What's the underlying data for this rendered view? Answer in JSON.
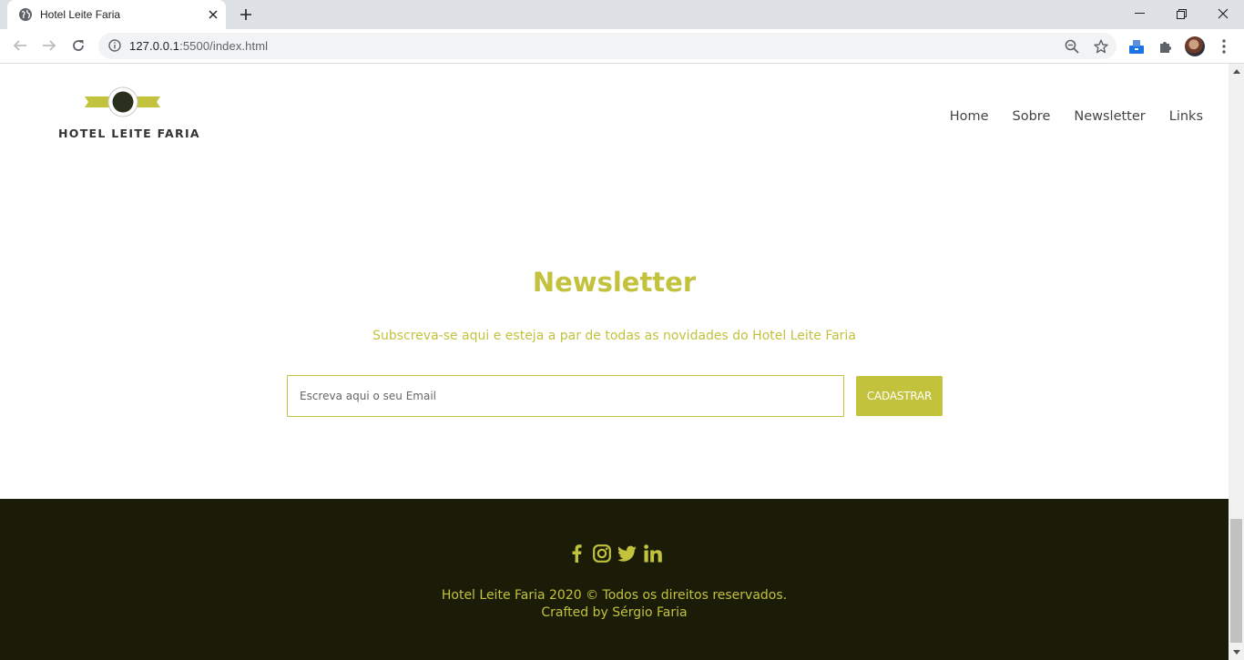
{
  "browser": {
    "tab_title": "Hotel Leite Faria",
    "url_host": "127.0.0.1",
    "url_rest": ":5500/index.html"
  },
  "header": {
    "logo_text": "HOTEL LEITE FARIA",
    "nav": [
      "Home",
      "Sobre",
      "Newsletter",
      "Links"
    ]
  },
  "newsletter": {
    "title": "Newsletter",
    "subtitle": "Subscreva-se aqui e esteja a par de todas as novidades do Hotel Leite Faria",
    "email_placeholder": "Escreva aqui o seu Email",
    "button_label": "CADASTRAR"
  },
  "footer": {
    "social_icons": [
      "facebook-icon",
      "instagram-icon",
      "twitter-icon",
      "linkedin-icon"
    ],
    "copyright": "Hotel Leite Faria 2020 © Todos os direitos reservados.",
    "credit": "Crafted by Sérgio Faria"
  },
  "colors": {
    "accent": "#c2c23d",
    "footer_bg": "#1b1c08",
    "chrome_bg": "#dee1e6"
  }
}
